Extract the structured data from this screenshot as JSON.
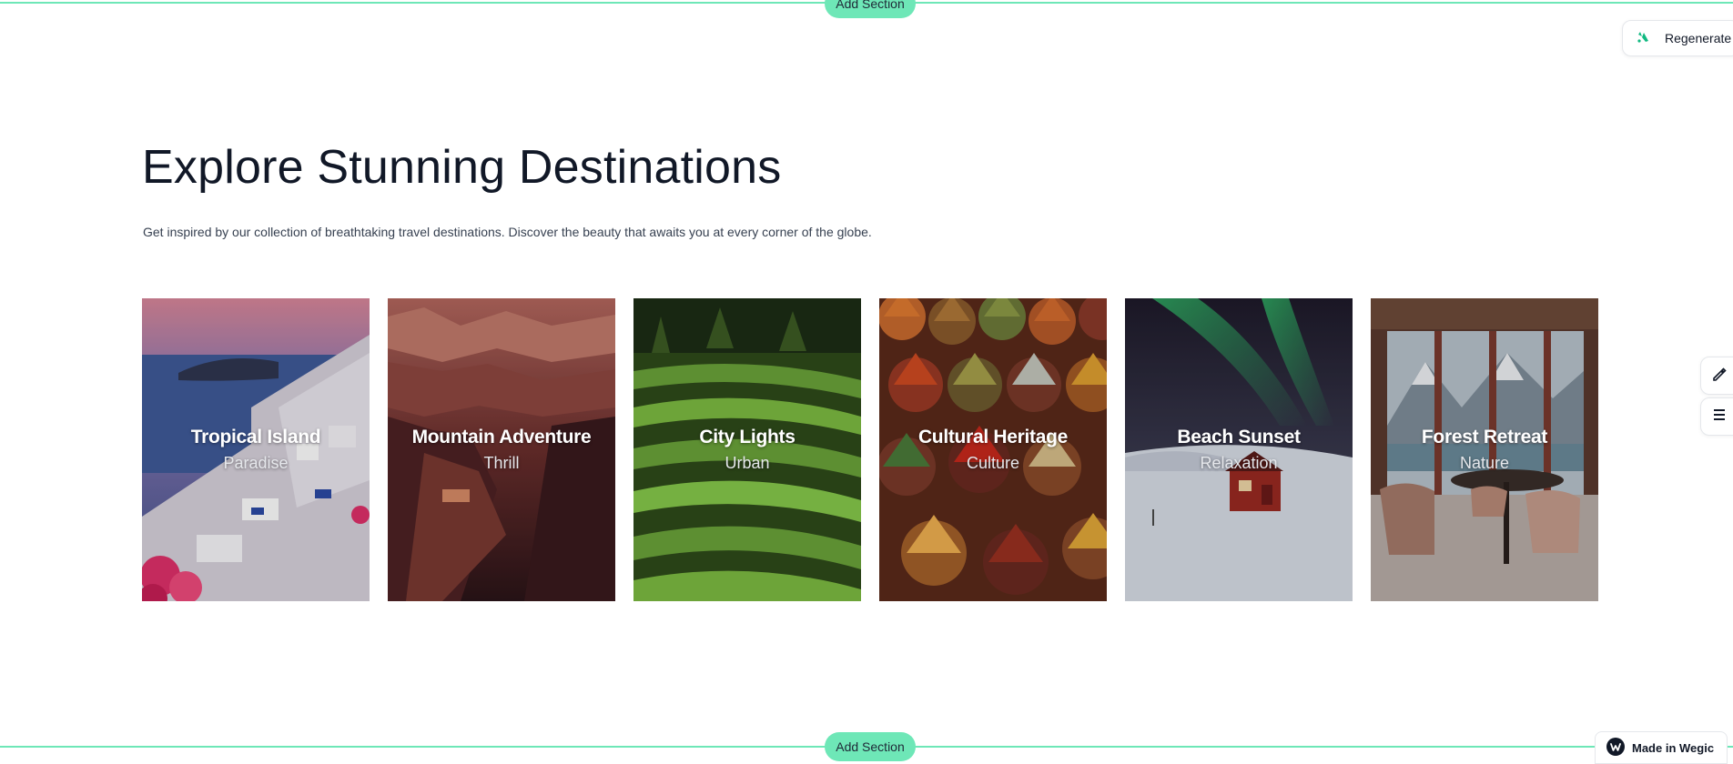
{
  "editor": {
    "add_section_label": "Add Section",
    "regenerate_label": "Regenerate",
    "badge_label": "Made in Wegic",
    "accent_color": "#6ee7b7"
  },
  "section": {
    "title": "Explore Stunning Destinations",
    "subtitle": "Get inspired by our collection of breathtaking travel destinations. Discover the beauty that awaits you at every corner of the globe."
  },
  "cards": [
    {
      "title": "Tropical Island",
      "subtitle": "Paradise"
    },
    {
      "title": "Mountain Adventure",
      "subtitle": "Thrill"
    },
    {
      "title": "City Lights",
      "subtitle": "Urban"
    },
    {
      "title": "Cultural Heritage",
      "subtitle": "Culture"
    },
    {
      "title": "Beach Sunset",
      "subtitle": "Relaxation"
    },
    {
      "title": "Forest Retreat",
      "subtitle": "Nature"
    }
  ]
}
